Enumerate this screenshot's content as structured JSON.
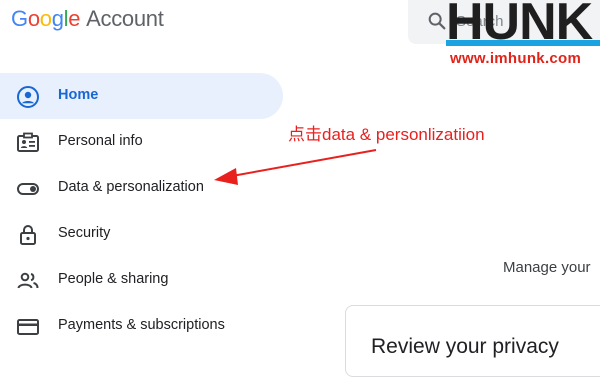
{
  "header": {
    "logo_word": [
      "G",
      "o",
      "o",
      "g",
      "l",
      "e"
    ],
    "logo_suffix": "Account",
    "search_placeholder": "Search"
  },
  "watermark": {
    "brand": "HUNK",
    "url": "www.imhunk.com"
  },
  "sidebar": {
    "items": [
      {
        "label": "Home",
        "icon": "account-circle-icon",
        "active": true
      },
      {
        "label": "Personal info",
        "icon": "id-card-icon",
        "active": false
      },
      {
        "label": "Data & personalization",
        "icon": "toggle-icon",
        "active": false
      },
      {
        "label": "Security",
        "icon": "lock-icon",
        "active": false
      },
      {
        "label": "People & sharing",
        "icon": "people-icon",
        "active": false
      },
      {
        "label": "Payments & subscriptions",
        "icon": "credit-card-icon",
        "active": false
      }
    ]
  },
  "annotation": {
    "text": "点击data & personlizatiion",
    "color": "#e8211f"
  },
  "main": {
    "manage_text": "Manage your",
    "card_title": "Review your privacy"
  },
  "colors": {
    "accent": "#1967d2",
    "active_bg": "#e8f0fe"
  }
}
